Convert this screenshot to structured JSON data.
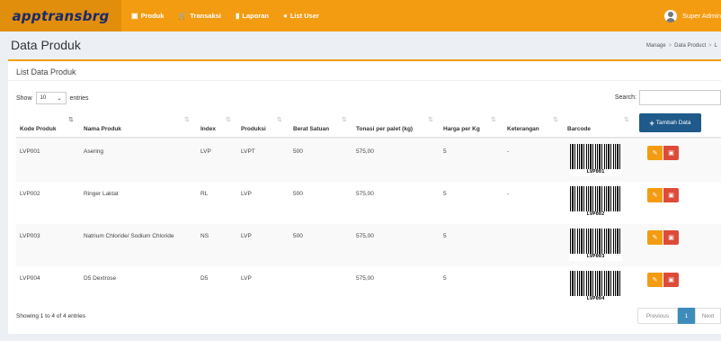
{
  "app": {
    "brand": "apptransbrg"
  },
  "nav": [
    {
      "label": "Produk",
      "icon": "box-icon"
    },
    {
      "label": "Transaksi",
      "icon": "cart-icon"
    },
    {
      "label": "Laporan",
      "icon": "file-icon"
    },
    {
      "label": "List User",
      "icon": "user-icon"
    }
  ],
  "user": {
    "name": "Super Admin"
  },
  "page": {
    "title": "Data Produk",
    "breadcrumb": [
      "Manage",
      "Data Product",
      "L"
    ]
  },
  "box": {
    "title": "List Data Produk",
    "show_label": "Show",
    "entries_value": "10",
    "entries_label": "entries",
    "search_label": "Search:",
    "search_value": "",
    "add_button": "Tambah Data"
  },
  "table": {
    "columns": [
      "Kode Produk",
      "Nama Produk",
      "Index",
      "Produksi",
      "Berat Satuan",
      "Tonasi per palet (kg)",
      "Harga per Kg",
      "Keterangan",
      "Barcode"
    ],
    "rows": [
      {
        "kode": "LVP001",
        "nama": "Asering",
        "index": "LVP",
        "produksi": "LVPT",
        "berat": "500",
        "tonasi": "575,00",
        "harga": "5",
        "ket": "-",
        "barcode": "LVP001"
      },
      {
        "kode": "LVP002",
        "nama": "Ringer Laktat",
        "index": "RL",
        "produksi": "LVP",
        "berat": "500",
        "tonasi": "575,00",
        "harga": "5",
        "ket": "-",
        "barcode": "LVP002"
      },
      {
        "kode": "LVP003",
        "nama": "Natrium Chloride/ Sodium Chloride",
        "index": "NS",
        "produksi": "LVP",
        "berat": "500",
        "tonasi": "575,00",
        "harga": "5",
        "ket": "",
        "barcode": "LVP003"
      },
      {
        "kode": "LVP004",
        "nama": "D5 Dextrose",
        "index": "D5",
        "produksi": "LVP",
        "berat": "",
        "tonasi": "575,00",
        "harga": "5",
        "ket": "",
        "barcode": "LVP004"
      }
    ]
  },
  "footer": {
    "info": "Showing 1 to 4 of 4 entries",
    "previous": "Previous",
    "current_page": "1",
    "next": "Next"
  },
  "colors": {
    "accent": "#f39c12",
    "primary": "#1f5a8a",
    "danger": "#dd4b39"
  }
}
